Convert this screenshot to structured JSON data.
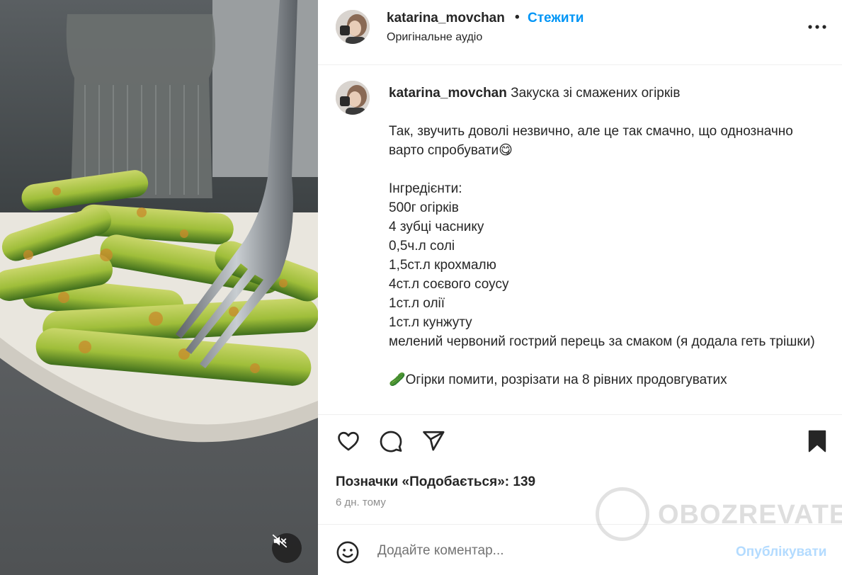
{
  "post": {
    "username": "katarina_movchan",
    "dot": "•",
    "follow_label": "Стежити",
    "audio": "Оригінальне аудіо"
  },
  "caption": {
    "username": "katarina_movchan",
    "title": "Закуска зі смажених огірків",
    "intro": "Так, звучить доволі незвично, але це так смачно, що однозначно варто спробувати😋",
    "ingredients_header": "Інгредієнти:",
    "ingredients": [
      "500г огірків",
      "4 зубці часнику",
      "0,5ч.л солі",
      "1,5ст.л крохмалю",
      "4ст.л соєвого соусу",
      "1ст.л олії",
      "1ст.л кунжуту",
      "мелений червоний гострий перець за смаком (я додала геть трішки)"
    ],
    "step1": "🥒Огірки помити, розрізати на 8 рівних продовгуватих"
  },
  "actions": {
    "likes_text": "Позначки «Подобається»: 139",
    "time": "6 дн. тому"
  },
  "comment": {
    "placeholder": "Додайте коментар...",
    "publish_label": "Опублікувати"
  },
  "watermark": {
    "text": "OBOZREVATEL"
  },
  "icons": {
    "like": "heart-icon",
    "comment": "comment-icon",
    "share": "send-icon",
    "save": "bookmark-icon",
    "more": "more-icon",
    "mute": "speaker-muted-icon",
    "emoji": "emoji-icon"
  },
  "colors": {
    "accent": "#0095f6",
    "publish_disabled": "#b3dbff",
    "muted_text": "#8e8e8e"
  }
}
